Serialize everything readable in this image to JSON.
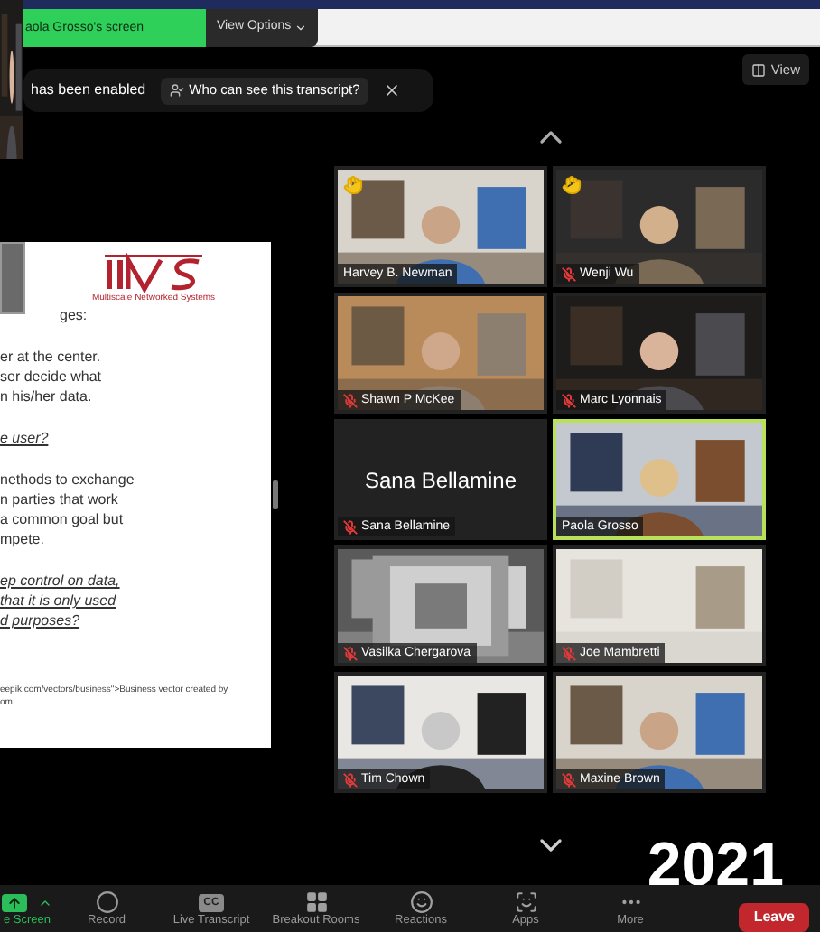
{
  "share_bar": {
    "label": "aola Grosso's screen",
    "view_options": "View Options"
  },
  "notification": {
    "text": "has been enabled",
    "link": "Who can see this transcript?"
  },
  "view_button": "View",
  "slide": {
    "logo_caption": "Multiscale Networked Systems",
    "blocks": [
      {
        "kind": "heading",
        "lines": [
          "ges:"
        ]
      },
      {
        "kind": "body",
        "lines": [
          "er at the center.",
          "ser decide what",
          "n his/her data."
        ]
      },
      {
        "kind": "question",
        "lines": [
          "e user?"
        ]
      },
      {
        "kind": "body",
        "lines": [
          "nethods to exchange",
          "n parties that work",
          "a common goal but",
          "mpete."
        ]
      },
      {
        "kind": "question",
        "lines": [
          "ep control on data,",
          "that it is only used",
          "d purposes?"
        ]
      },
      {
        "kind": "footnote",
        "lines": [
          "eepik.com/vectors/business\">Business vector created by",
          "om"
        ]
      }
    ]
  },
  "tiles": [
    {
      "kind": "video",
      "name": "Harvey B. Newman",
      "muted": false,
      "hand_raised": true,
      "speaking": false
    },
    {
      "kind": "video",
      "name": "Wenji Wu",
      "muted": true,
      "hand_raised": true,
      "speaking": false
    },
    {
      "kind": "video",
      "name": "Shawn P McKee",
      "muted": true,
      "hand_raised": false,
      "speaking": false
    },
    {
      "kind": "video",
      "name": "Marc Lyonnais",
      "muted": true,
      "hand_raised": false,
      "speaking": false
    },
    {
      "kind": "name_only",
      "display_name": "Sana Bellamine",
      "name": "Sana Bellamine",
      "muted": true,
      "hand_raised": false,
      "speaking": false
    },
    {
      "kind": "video",
      "name": "Paola Grosso",
      "muted": false,
      "hand_raised": false,
      "speaking": true
    },
    {
      "kind": "video",
      "name": "Vasilka Chergarova",
      "muted": true,
      "hand_raised": false,
      "speaking": false
    },
    {
      "kind": "video",
      "name": "Joe Mambretti",
      "muted": true,
      "hand_raised": false,
      "speaking": false
    },
    {
      "kind": "video",
      "name": "Tim Chown",
      "muted": true,
      "hand_raised": false,
      "speaking": false
    },
    {
      "kind": "video",
      "name": "Maxine Brown",
      "muted": true,
      "hand_raised": false,
      "speaking": false
    }
  ],
  "toolbar": {
    "items": [
      {
        "kind": "share",
        "label": "e Screen"
      },
      {
        "kind": "record",
        "label": "Record"
      },
      {
        "kind": "cc",
        "label": "Live Transcript",
        "icon_text": "CC"
      },
      {
        "kind": "rooms",
        "label": "Breakout Rooms"
      },
      {
        "kind": "reactions",
        "label": "Reactions"
      },
      {
        "kind": "apps",
        "label": "Apps"
      },
      {
        "kind": "more",
        "label": "More"
      }
    ],
    "leave": "Leave"
  },
  "year_overlay": "2021"
}
